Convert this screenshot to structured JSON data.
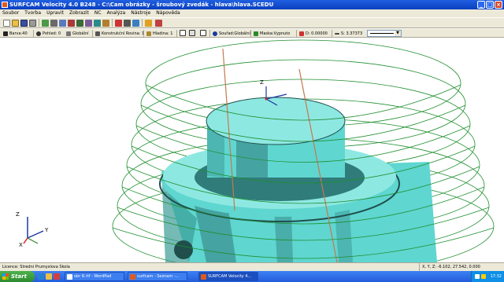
{
  "window": {
    "title": "SURFCAM Velocity 4.0 B248 - C:\\Cam obrázky - šroubový zvedák - hlava\\hlava.SCEDU"
  },
  "menu": [
    "Soubor",
    "Tvorba",
    "Upravit",
    "Zobrazit",
    "NC",
    "Analýza",
    "Nástroje",
    "Nápověda"
  ],
  "properties_bar": {
    "color": "Barva:40",
    "view": "Pohled: 0",
    "view_space": "Globální",
    "construction_plane": "Konstrukční Rovina: 1",
    "layer": "Hladina: 1",
    "coordinates": "Souřad:Globální",
    "mask": "Maska:Vypnuto",
    "depth": "D: 0.00000",
    "spacing": "S: 3.37373",
    "line_style": "solid"
  },
  "status": {
    "licence": "Licence: Stredni Prumyslova Skola",
    "xyz_label": "X, Y, Z:",
    "xyz_value": "-6.102, 27.542, 0.000"
  },
  "taskbar": {
    "start_label": "Start",
    "tasks": [
      "obr 8.rtf - WordPad",
      "surfcam - Seznam -...",
      "SURFCAM Velocity 4..."
    ],
    "clock": "17:32"
  },
  "axis_labels": {
    "x": "X",
    "y": "Y",
    "z": "Z"
  },
  "colors": {
    "solid": "#5fd6d0",
    "solid_dark": "#2f7c7a",
    "helix": "#1f8f2f",
    "axis_line": "#c47850"
  }
}
